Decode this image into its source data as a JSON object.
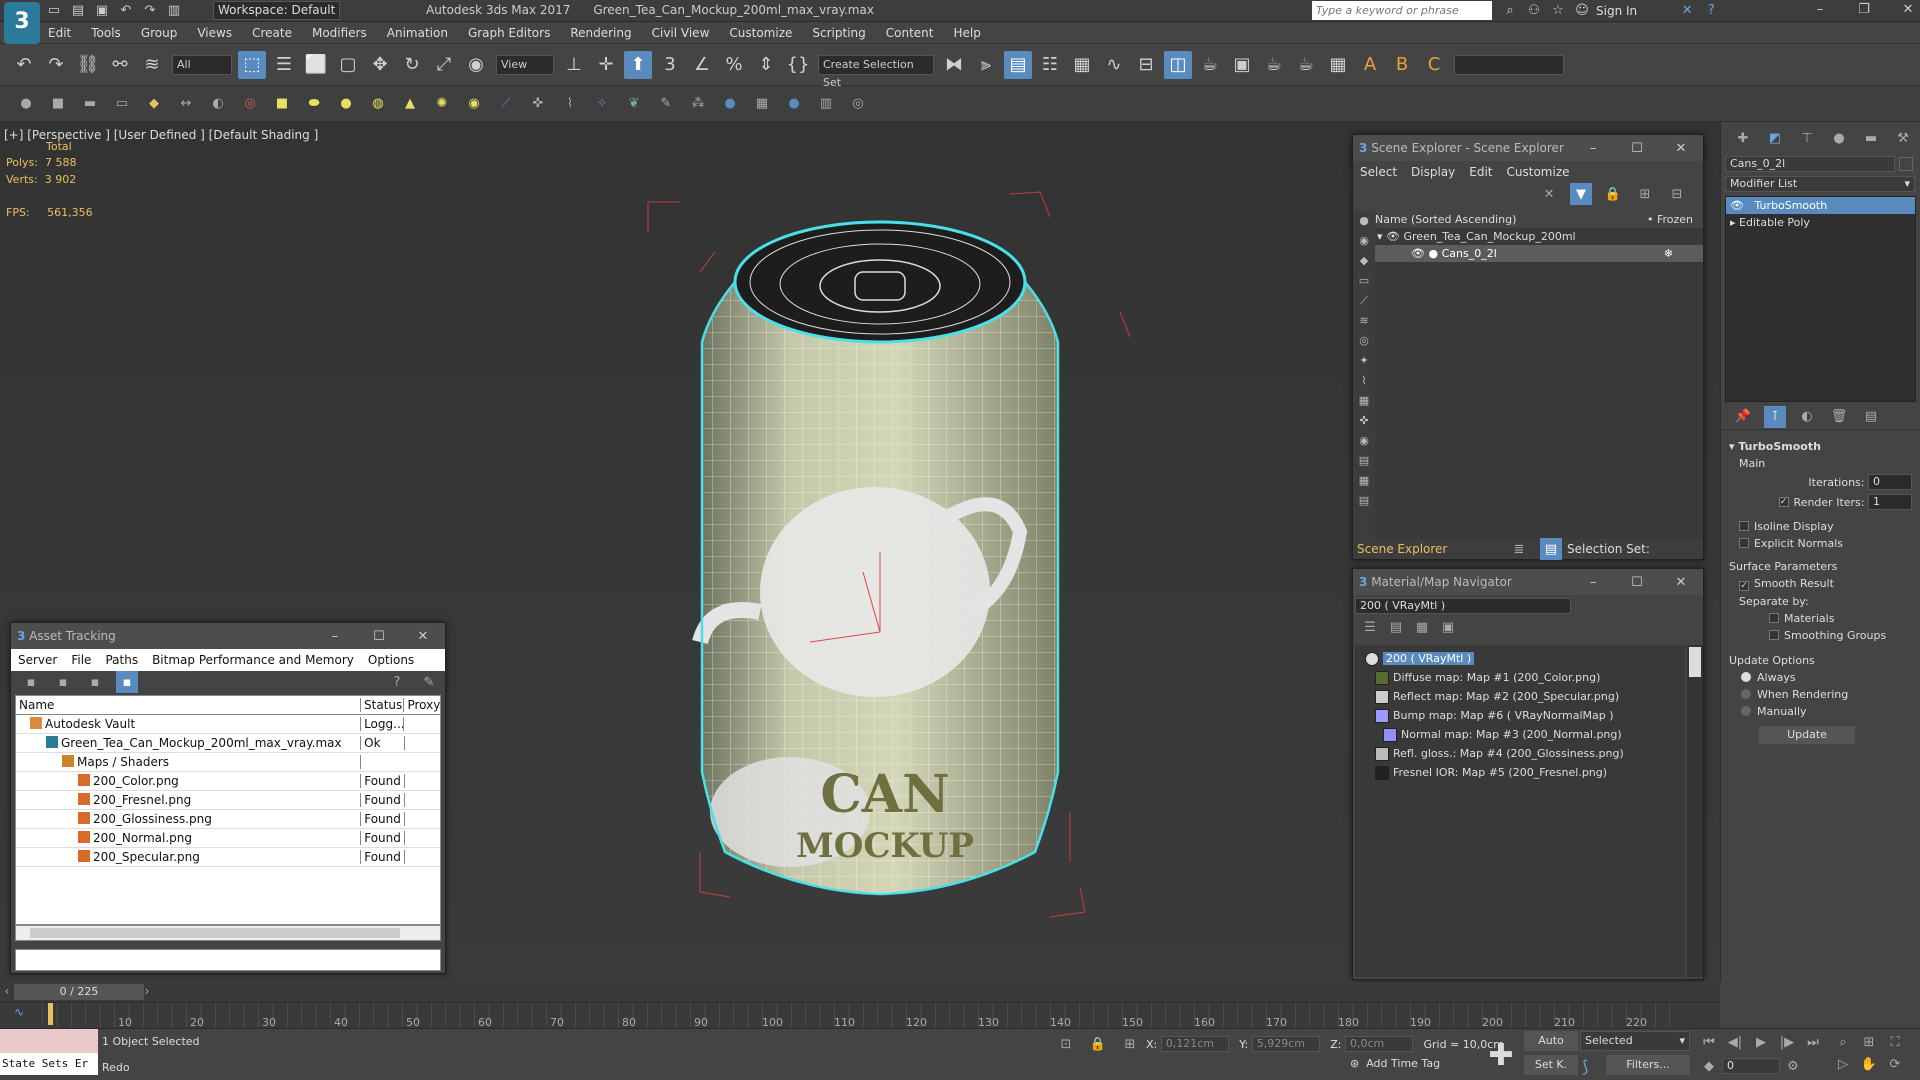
{
  "app": {
    "title": "Autodesk 3ds Max 2017",
    "file": "Green_Tea_Can_Mockup_200ml_max_vray.max",
    "workspace": "Workspace: Default",
    "search_placeholder": "Type a keyword or phrase",
    "sign_in": "Sign In"
  },
  "menu": [
    "Edit",
    "Tools",
    "Group",
    "Views",
    "Create",
    "Modifiers",
    "Animation",
    "Graph Editors",
    "Rendering",
    "Civil View",
    "Customize",
    "Scripting",
    "Content",
    "Help"
  ],
  "toolbar": {
    "filter": "All",
    "refcoord": "View",
    "selset": "Create Selection Set"
  },
  "viewport": {
    "label": "[+] [Perspective ]  [User Defined ]  [Default Shading ]",
    "total": "Total",
    "polys_label": "Polys:",
    "polys": "7 588",
    "verts_label": "Verts:",
    "verts": "3 902",
    "fps_label": "FPS:",
    "fps": "561,356",
    "can_text1": "CAN",
    "can_text2": "MOCKUP"
  },
  "scene_explorer": {
    "title": "Scene Explorer - Scene Explorer",
    "menu": [
      "Select",
      "Display",
      "Edit",
      "Customize"
    ],
    "col_name": "Name (Sorted Ascending)",
    "col_frozen": "• Frozen",
    "items": [
      {
        "name": "Green_Tea_Can_Mockup_200ml"
      },
      {
        "name": "Cans_0_2l"
      }
    ],
    "footer_label": "Scene Explorer",
    "selection_set": "Selection Set:"
  },
  "material_nav": {
    "title": "Material/Map Navigator",
    "field": "200  ( VRayMtl )",
    "root": "200  ( VRayMtl )",
    "maps": [
      {
        "label": "Diffuse map: Map #1 (200_Color.png)",
        "color": "#556b2f"
      },
      {
        "label": "Reflect map: Map #2 (200_Specular.png)",
        "color": "#cccccc"
      },
      {
        "label": "Bump map: Map #6  ( VRayNormalMap )",
        "color": "#9a9aff"
      },
      {
        "label": "Normal map: Map #3 (200_Normal.png)",
        "color": "#8f8fff"
      },
      {
        "label": "Refl. gloss.: Map #4 (200_Glossiness.png)",
        "color": "#bbbbbb"
      },
      {
        "label": "Fresnel IOR: Map #5 (200_Fresnel.png)",
        "color": "#222222"
      }
    ]
  },
  "asset_tracking": {
    "title": "Asset Tracking",
    "menu": [
      "Server",
      "File",
      "Paths",
      "Bitmap Performance and Memory",
      "Options"
    ],
    "cols": [
      "Name",
      "Status",
      "Proxy..."
    ],
    "rows": [
      {
        "name": "Autodesk Vault",
        "status": "Logg...",
        "indent": 1
      },
      {
        "name": "Green_Tea_Can_Mockup_200ml_max_vray.max",
        "status": "Ok",
        "indent": 2
      },
      {
        "name": "Maps / Shaders",
        "status": "",
        "indent": 3
      },
      {
        "name": "200_Color.png",
        "status": "Found",
        "indent": 4
      },
      {
        "name": "200_Fresnel.png",
        "status": "Found",
        "indent": 4
      },
      {
        "name": "200_Glossiness.png",
        "status": "Found",
        "indent": 4
      },
      {
        "name": "200_Normal.png",
        "status": "Found",
        "indent": 4
      },
      {
        "name": "200_Specular.png",
        "status": "Found",
        "indent": 4
      }
    ]
  },
  "modify_panel": {
    "object_name": "Cans_0_2l",
    "modifier_list": "Modifier List",
    "stack": [
      "TurboSmooth",
      "Editable Poly"
    ],
    "rollout": "TurboSmooth",
    "main": "Main",
    "iterations_label": "Iterations:",
    "iterations": "0",
    "render_iters_label": "Render Iters:",
    "render_iters": "1",
    "isoline": "Isoline Display",
    "explicit": "Explicit Normals",
    "surface": "Surface Parameters",
    "smooth_result": "Smooth Result",
    "separate": "Separate by:",
    "materials": "Materials",
    "smoothing": "Smoothing Groups",
    "update_opts": "Update Options",
    "always": "Always",
    "when_rendering": "When Rendering",
    "manually": "Manually",
    "update_btn": "Update"
  },
  "timeline": {
    "frame": "0 / 225",
    "ticks": [
      "10",
      "20",
      "30",
      "40",
      "50",
      "60",
      "70",
      "80",
      "90",
      "100",
      "110",
      "120",
      "130",
      "140",
      "150",
      "160",
      "170",
      "180",
      "190",
      "200",
      "210",
      "220"
    ]
  },
  "status": {
    "state_sets": "State Sets Er",
    "selected": "1 Object Selected",
    "redo": "Redo",
    "x_label": "X:",
    "x": "0,121cm",
    "y_label": "Y:",
    "y": "5,929cm",
    "z_label": "Z:",
    "z": "0,0cm",
    "grid": "Grid = 10,0cm",
    "auto": "Auto",
    "set_key": "Set K.",
    "selected_dd": "Selected",
    "filters": "Filters...",
    "add_time_tag": "Add Time Tag",
    "frame_field": "0"
  },
  "colors": {
    "selection": "#5a8bbf",
    "accent_yellow": "#e8c060",
    "highlight_cyan": "#49e0e8"
  }
}
